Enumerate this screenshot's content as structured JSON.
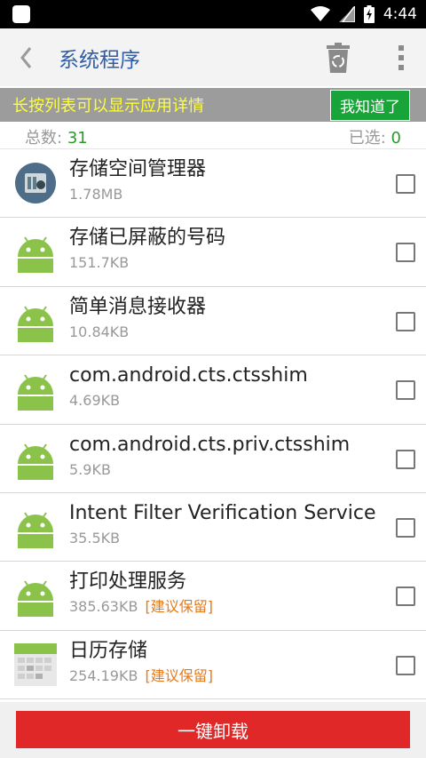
{
  "status": {
    "time": "4:44"
  },
  "toolbar": {
    "title": "系统程序"
  },
  "banner": {
    "text": "长按列表可以显示应用详情",
    "button": "我知道了"
  },
  "counts": {
    "total_label": "总数:",
    "total": "31",
    "selected_label": "已选:",
    "selected": "0"
  },
  "apps": [
    {
      "name": "存储空间管理器",
      "size": "1.78MB",
      "keep": "",
      "icon": "storage-manager-icon"
    },
    {
      "name": "存储已屏蔽的号码",
      "size": "151.7KB",
      "keep": "",
      "icon": "android-icon"
    },
    {
      "name": "简单消息接收器",
      "size": "10.84KB",
      "keep": "",
      "icon": "android-icon"
    },
    {
      "name": "com.android.cts.ctsshim",
      "size": "4.69KB",
      "keep": "",
      "icon": "android-icon"
    },
    {
      "name": "com.android.cts.priv.ctsshim",
      "size": "5.9KB",
      "keep": "",
      "icon": "android-icon"
    },
    {
      "name": "Intent Filter Verification Service",
      "size": "35.5KB",
      "keep": "",
      "icon": "android-icon"
    },
    {
      "name": "打印处理服务",
      "size": "385.63KB",
      "keep": "[建议保留]",
      "icon": "android-icon"
    },
    {
      "name": "日历存储",
      "size": "254.19KB",
      "keep": "[建议保留]",
      "icon": "calendar-storage-icon"
    }
  ],
  "bottom": {
    "uninstall_label": "一键卸载"
  },
  "colors": {
    "title_blue": "#2f5ea7",
    "banner_yellow": "#ffff33",
    "green": "#19a43a",
    "red": "#e02828",
    "keep_orange": "#e67a1a"
  }
}
